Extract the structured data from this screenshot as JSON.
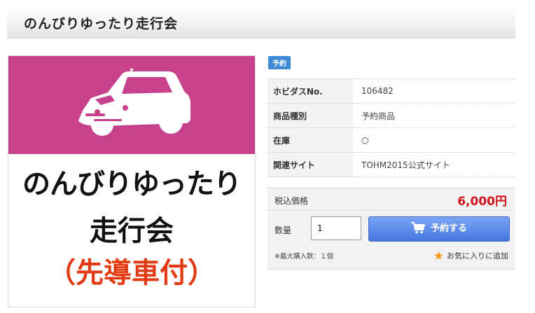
{
  "page": {
    "title": "のんびりゆったり走行会"
  },
  "image": {
    "line1": "のんびりゆったり",
    "line2": "走行会",
    "line3": "（先導車付）",
    "top_color": "#c8418c",
    "icon": "car-icon"
  },
  "badge": "予約",
  "info_rows": [
    {
      "label": "ホビダスNo.",
      "value": "106482"
    },
    {
      "label": "商品種別",
      "value": "予約商品"
    },
    {
      "label": "在庫",
      "value": "○"
    },
    {
      "label": "関連サイト",
      "value": "TOHM2015公式サイト"
    }
  ],
  "purchase": {
    "price_label": "税込価格",
    "price_value": "6,000円",
    "quantity_label": "数量",
    "quantity_value": "1",
    "reserve_label": "予約する",
    "max_note": "※最大購入数：１個",
    "favorite_label": "お気に入りに追加"
  },
  "colors": {
    "accent": "#4576e0",
    "price": "#d0121b",
    "badge": "#3e8ad6",
    "star": "#f39c1a"
  }
}
